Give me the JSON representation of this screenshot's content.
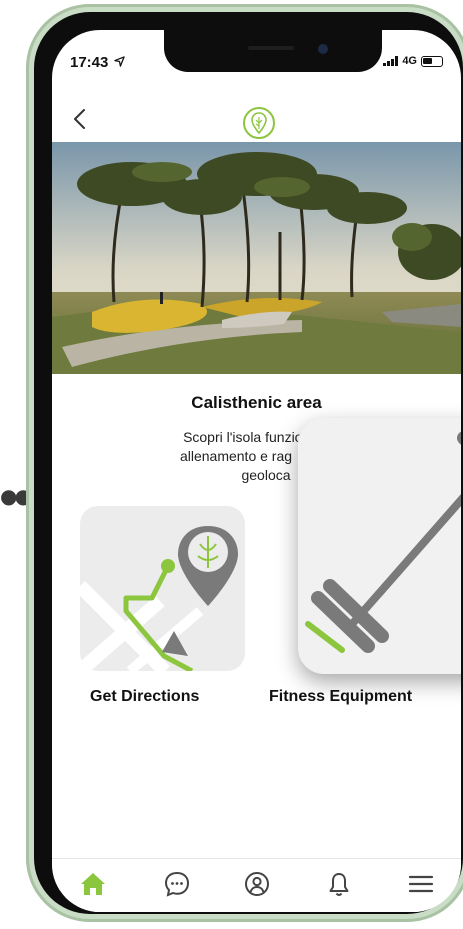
{
  "status_bar": {
    "time": "17:43",
    "location_arrow": "location-arrow-icon",
    "network": "4G"
  },
  "header": {
    "back_icon": "chevron-left-icon",
    "logo_icon": "tree-pin-logo-icon"
  },
  "hero": {
    "image": "park-with-trees-photo"
  },
  "content": {
    "title": "Calisthenic area",
    "description_lines": [
      "Scopri l'isola funzionale",
      "allenamento e rag",
      "geoloca"
    ]
  },
  "tiles": [
    {
      "label": "Get Directions",
      "icon": "map-directions-icon"
    },
    {
      "label": "Fitness Equipment",
      "icon": "barbell-icon"
    }
  ],
  "left_indicator": "●●●",
  "tabbar": [
    {
      "name": "home",
      "icon": "home-icon",
      "active": true
    },
    {
      "name": "chat",
      "icon": "chat-bubble-icon",
      "active": false
    },
    {
      "name": "profile",
      "icon": "user-circle-icon",
      "active": false
    },
    {
      "name": "notifications",
      "icon": "bell-icon",
      "active": false
    },
    {
      "name": "menu",
      "icon": "menu-icon",
      "active": false
    }
  ],
  "colors": {
    "accent_green": "#8cc63f",
    "icon_gray": "#7a7a7a",
    "phone_frame": "#c9dcc5"
  }
}
